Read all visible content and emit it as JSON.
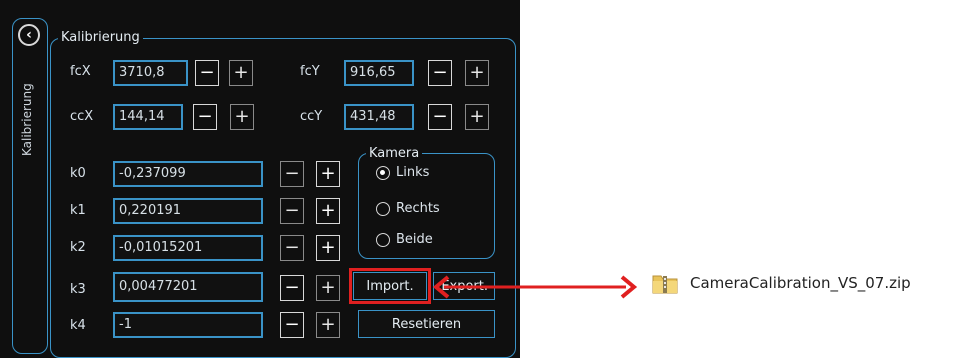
{
  "window": {
    "back_icon": "chevron-left-icon",
    "side_tab_label": "Kalibrierung"
  },
  "calibration": {
    "group_title": "Kalibrierung",
    "focal": [
      {
        "label": "fcX",
        "value": "3710,8"
      },
      {
        "label": "fcY",
        "value": "916,65"
      }
    ],
    "center": [
      {
        "label": "ccX",
        "value": "144,14"
      },
      {
        "label": "ccY",
        "value": "431,48"
      }
    ],
    "distortion": [
      {
        "label": "k0",
        "value": "-0,237099"
      },
      {
        "label": "k1",
        "value": "0,220191"
      },
      {
        "label": "k2",
        "value": "-0,01015201"
      },
      {
        "label": "k3",
        "value": "0,00477201"
      },
      {
        "label": "k4",
        "value": "-1"
      }
    ],
    "minus_symbol": "−",
    "plus_symbol": "+"
  },
  "camera": {
    "group_title": "Kamera",
    "options": [
      "Links",
      "Rechts",
      "Beide"
    ],
    "selected": "Links"
  },
  "buttons": {
    "import": "Import.",
    "export": "Export.",
    "reset": "Resetieren"
  },
  "annotation": {
    "file_name": "CameraCalibration_VS_07.zip",
    "highlight_color": "#e02020",
    "file_icon": "zip-folder-icon"
  },
  "colors": {
    "accent": "#3a93c7",
    "background": "#0f0f0f"
  }
}
